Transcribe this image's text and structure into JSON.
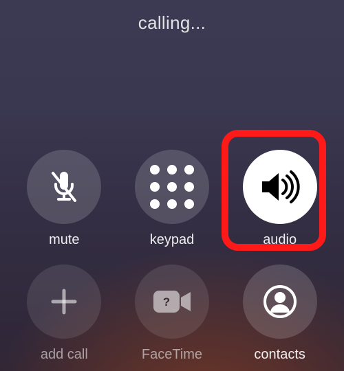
{
  "status_text": "calling...",
  "buttons": {
    "mute": {
      "label": "mute"
    },
    "keypad": {
      "label": "keypad"
    },
    "audio": {
      "label": "audio",
      "active": true,
      "highlighted": true
    },
    "add_call": {
      "label": "add call"
    },
    "facetime": {
      "label": "FaceTime"
    },
    "contacts": {
      "label": "contacts"
    }
  },
  "colors": {
    "highlight": "#ff1a1a",
    "icon_light": "#ffffff",
    "icon_dark": "#000000"
  }
}
